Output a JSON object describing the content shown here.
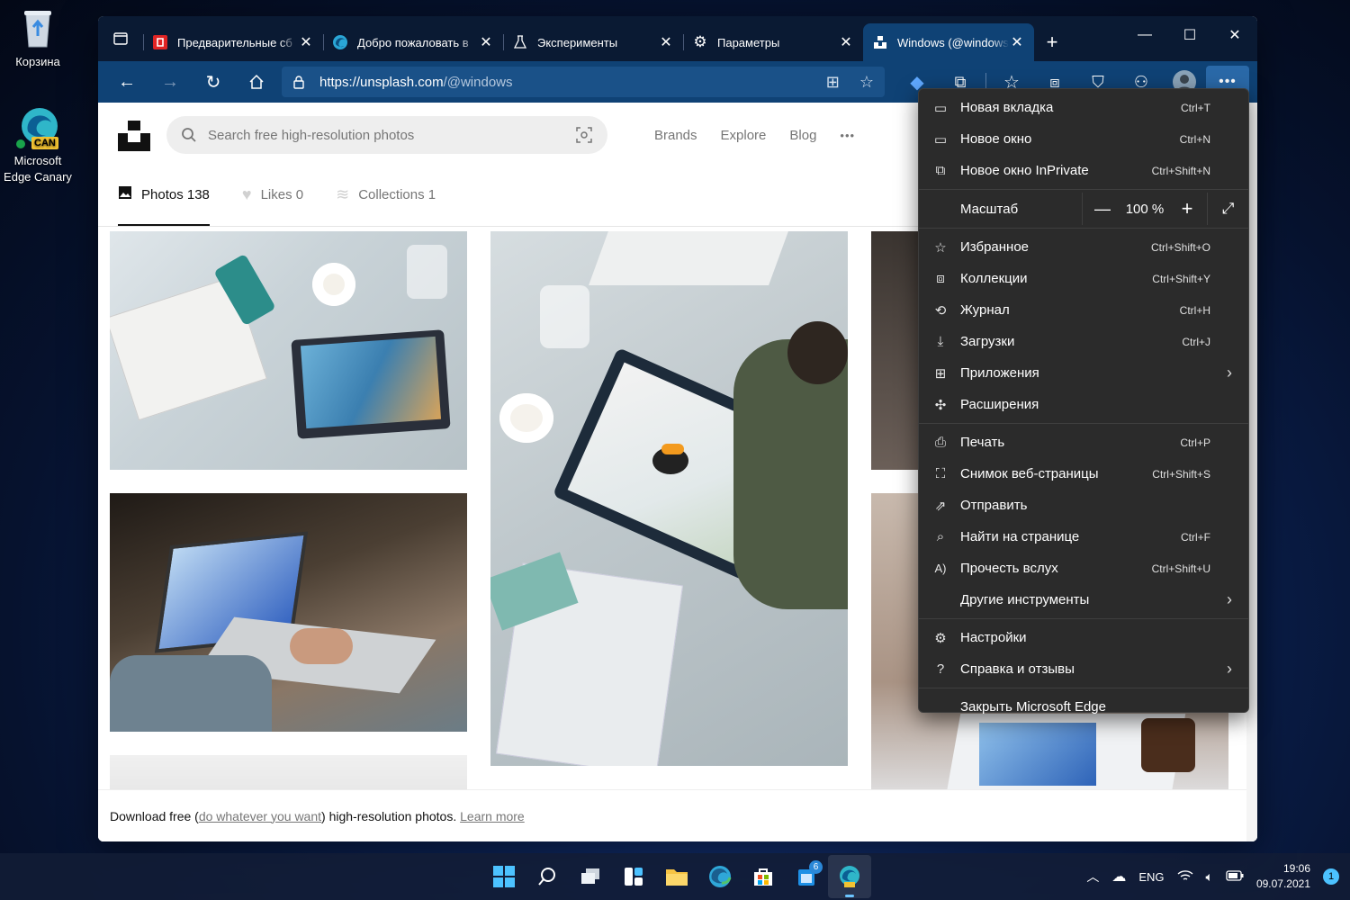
{
  "desktop": {
    "recycle_bin": "Корзина",
    "edge_canary_line1": "Microsoft",
    "edge_canary_line2": "Edge Canary",
    "can_badge": "CAN"
  },
  "tabs": [
    {
      "title": "Предварительные сб",
      "icon": "office-icon"
    },
    {
      "title": "Добро пожаловать в",
      "icon": "edge-icon"
    },
    {
      "title": "Эксперименты",
      "icon": "flask-icon"
    },
    {
      "title": "Параметры",
      "icon": "gear-icon"
    },
    {
      "title": "Windows (@windows)",
      "icon": "unsplash-icon",
      "active": true
    }
  ],
  "address": {
    "host": "https://unsplash.com",
    "path": "/@windows"
  },
  "unsplash": {
    "search_placeholder": "Search free high-resolution photos",
    "nav": [
      "Brands",
      "Explore",
      "Blog"
    ],
    "more": "•••",
    "profile_tabs": [
      {
        "label": "Photos 138",
        "icon": "image-icon",
        "active": true
      },
      {
        "label": "Likes 0",
        "icon": "heart-icon"
      },
      {
        "label": "Collections 1",
        "icon": "stack-icon"
      }
    ],
    "footer": {
      "text1": "Download free (",
      "link1": "do whatever you want",
      "text2": ") high-resolution photos. ",
      "link2": "Learn more"
    }
  },
  "menu": {
    "items": [
      {
        "label": "Новая вкладка",
        "shortcut": "Ctrl+T",
        "icon": "new-tab-icon"
      },
      {
        "label": "Новое окно",
        "shortcut": "Ctrl+N",
        "icon": "new-window-icon"
      },
      {
        "label": "Новое окно InPrivate",
        "shortcut": "Ctrl+Shift+N",
        "icon": "inprivate-icon"
      },
      {
        "label": "Масштаб",
        "type": "zoom",
        "value": "100 %"
      },
      {
        "label": "Избранное",
        "shortcut": "Ctrl+Shift+O",
        "icon": "favorites-icon"
      },
      {
        "label": "Коллекции",
        "shortcut": "Ctrl+Shift+Y",
        "icon": "collections-icon"
      },
      {
        "label": "Журнал",
        "shortcut": "Ctrl+H",
        "icon": "history-icon"
      },
      {
        "label": "Загрузки",
        "shortcut": "Ctrl+J",
        "icon": "download-icon"
      },
      {
        "label": "Приложения",
        "submenu": true,
        "icon": "apps-icon"
      },
      {
        "label": "Расширения",
        "icon": "extensions-icon"
      },
      {
        "label": "Печать",
        "shortcut": "Ctrl+P",
        "icon": "print-icon"
      },
      {
        "label": "Снимок веб-страницы",
        "shortcut": "Ctrl+Shift+S",
        "icon": "web-capture-icon"
      },
      {
        "label": "Отправить",
        "icon": "share-icon"
      },
      {
        "label": "Найти на странице",
        "shortcut": "Ctrl+F",
        "icon": "find-icon"
      },
      {
        "label": "Прочесть вслух",
        "shortcut": "Ctrl+Shift+U",
        "icon": "read-aloud-icon"
      },
      {
        "label": "Другие инструменты",
        "submenu": true
      },
      {
        "label": "Настройки",
        "icon": "settings-icon"
      },
      {
        "label": "Справка и отзывы",
        "submenu": true,
        "icon": "help-icon"
      },
      {
        "label": "Закрыть Microsoft Edge"
      }
    ]
  },
  "taskbar": {
    "language": "ENG",
    "time": "19:06",
    "date": "09.07.2021",
    "notification_count": "1",
    "mail_badge": "6"
  }
}
